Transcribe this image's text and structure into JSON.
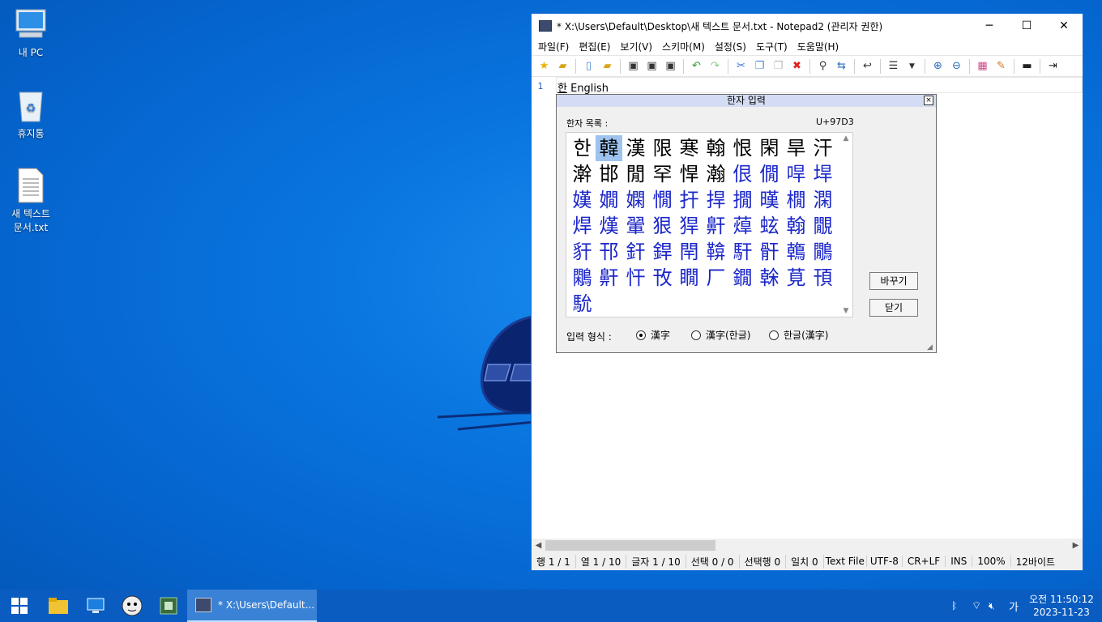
{
  "desktop": {
    "icons": [
      {
        "label": "내 PC",
        "icon": "computer-icon"
      },
      {
        "label": "휴지통",
        "icon": "recycle-bin-icon"
      },
      {
        "label_line1": "새 텍스트",
        "label_line2": "문서.txt",
        "icon": "text-file-icon"
      }
    ]
  },
  "window": {
    "title": "* X:\\Users\\Default\\Desktop\\새 텍스트 문서.txt - Notepad2 (관리자 권한)",
    "minimize": "─",
    "maximize": "☐",
    "close": "✕",
    "menu": [
      "파일(F)",
      "편집(E)",
      "보기(V)",
      "스키마(M)",
      "설정(S)",
      "도구(T)",
      "도움말(H)"
    ],
    "toolbar_icons": [
      "new-favorite-icon",
      "open-folder-icon",
      "new-file-icon",
      "browse-icon",
      "save-icon",
      "save-as-icon",
      "save-copy-icon",
      "undo-icon",
      "redo-icon",
      "cut-icon",
      "copy-icon",
      "paste-icon",
      "delete-icon",
      "find-icon",
      "replace-icon",
      "word-wrap-icon",
      "list-icon",
      "dropdown-icon",
      "zoom-in-icon",
      "zoom-out-icon",
      "scheme-icon",
      "customize-icon",
      "terminal-icon",
      "exit-icon"
    ],
    "line_number": "1",
    "line_text_hangul": "한",
    "line_text_rest": " English",
    "status": [
      "행 1 / 1",
      "열 1 / 10",
      "글자 1 / 10",
      "선택 0 / 0",
      "선택행 0",
      "일치 0",
      "Text File",
      "UTF-8",
      "CR+LF",
      "INS",
      "100%",
      "12바이트"
    ]
  },
  "hanja_dialog": {
    "title": "한자 입력",
    "close": "×",
    "list_label": "한자 목록 :",
    "code": "U+97D3",
    "chars_black": [
      "한",
      "韓",
      "漢",
      "限",
      "寒",
      "翰",
      "恨",
      "閑",
      "旱",
      "汗",
      "澣",
      "邯",
      "閒",
      "罕",
      "悍",
      "瀚"
    ],
    "chars_blue": [
      "佷",
      "僩",
      "哻",
      "垾",
      "嫨",
      "嫺",
      "嫻",
      "憪",
      "扞",
      "捍",
      "撊",
      "暵",
      "橌",
      "澖",
      "焊",
      "熯",
      "翬",
      "狠",
      "猂",
      "鼾",
      "蔊",
      "蚿",
      "翰",
      "覵",
      "豻",
      "邗",
      "釬",
      "銲",
      "閈",
      "鞥",
      "馯",
      "骭",
      "鶾",
      "鷳",
      "鷴",
      "鼾",
      "忓",
      "攼",
      "瞯",
      "厂",
      "鐗",
      "榦",
      "莧",
      "頇",
      "馻"
    ],
    "selected_index": 1,
    "buttons": {
      "change": "바꾸기",
      "close_button": "닫기"
    },
    "mode_label": "입력 형식 :",
    "modes": [
      "漢字",
      "漢字(한글)",
      "한글(漢字)"
    ],
    "mode_selected": 0
  },
  "taskbar": {
    "active_task": "* X:\\Users\\Default...",
    "pinned": [
      "windows-start-icon",
      "file-explorer-icon",
      "monitor-app-icon",
      "avatar-app-icon",
      "cpu-app-icon",
      "notepad2-icon"
    ],
    "tray": [
      "bluetooth-icon",
      "network-icon",
      "volume-muted-icon"
    ],
    "ime": "가",
    "time": "오전 11:50:12",
    "date": "2023-11-23"
  }
}
